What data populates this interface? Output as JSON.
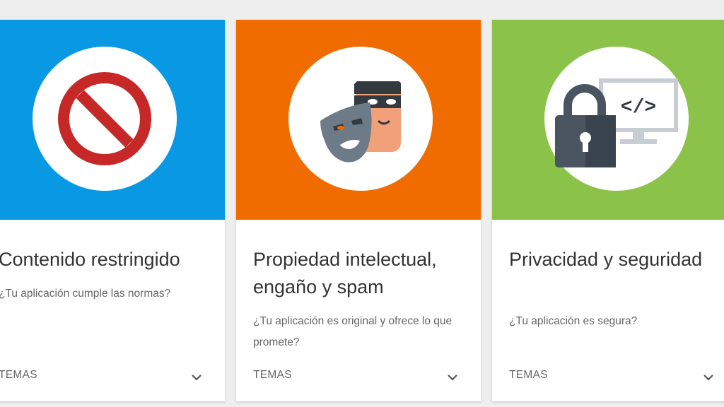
{
  "colors": {
    "blue_banner": "#0999e4",
    "orange_banner": "#f06c00",
    "green_banner": "#8bc34a",
    "text_primary": "#333333",
    "text_secondary": "#666666"
  },
  "cards": [
    {
      "title": "Contenido restringido",
      "subtitle": "¿Tu aplicación cumple las normas?",
      "footer_label": "TEMAS",
      "icon": "no-entry-icon",
      "expand_icon": "chevron-down-icon"
    },
    {
      "title": "Propiedad intelectual, engaño y spam",
      "subtitle": "¿Tu aplicación es original y ofrece lo que promete?",
      "footer_label": "TEMAS",
      "icon": "masks-icon",
      "expand_icon": "chevron-down-icon"
    },
    {
      "title": "Privacidad y seguridad",
      "subtitle": "¿Tu aplicación es segura?",
      "footer_label": "TEMAS",
      "icon": "lock-monitor-icon",
      "expand_icon": "chevron-down-icon"
    }
  ]
}
